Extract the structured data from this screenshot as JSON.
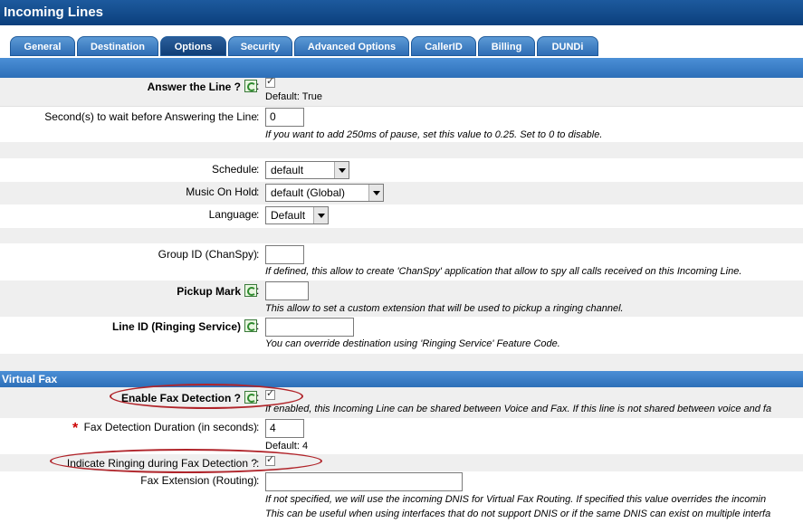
{
  "window": {
    "title": "Incoming Lines"
  },
  "tabs": [
    {
      "label": "General"
    },
    {
      "label": "Destination"
    },
    {
      "label": "Options",
      "active": true
    },
    {
      "label": "Security"
    },
    {
      "label": "Advanced Options"
    },
    {
      "label": "CallerID"
    },
    {
      "label": "Billing"
    },
    {
      "label": "DUNDi"
    }
  ],
  "options": {
    "answer_line": {
      "label": "Answer the Line ?",
      "checked": true,
      "default": "Default: True"
    },
    "wait_seconds": {
      "label": "Second(s) to wait before Answering the Line",
      "value": "0",
      "note": "If you want to add 250ms of pause, set this value to 0.25. Set to 0 to disable."
    },
    "schedule": {
      "label": "Schedule",
      "value": "default"
    },
    "music_on_hold": {
      "label": "Music On Hold",
      "value": "default (Global)"
    },
    "language": {
      "label": "Language",
      "value": "Default"
    },
    "group_id": {
      "label": "Group ID (ChanSpy)",
      "value": "",
      "note": "If defined, this allow to create 'ChanSpy' application that allow to spy all calls received on this Incoming Line."
    },
    "pickup_mark": {
      "label": "Pickup Mark",
      "value": "",
      "note": "This allow to set a custom extension that will be used to pickup a ringing channel."
    },
    "line_id": {
      "label": "Line ID (Ringing Service)",
      "value": "",
      "note": "You can override destination using 'Ringing Service' Feature Code."
    }
  },
  "virtual_fax": {
    "section_title": "Virtual Fax",
    "enable_fax_detection": {
      "label": "Enable Fax Detection ?",
      "checked": true,
      "note": "If enabled, this Incoming Line can be shared between Voice and Fax. If this line is not shared between voice and fa"
    },
    "fax_detection_duration": {
      "required_mark": "*",
      "label": "Fax Detection Duration (in seconds)",
      "value": "4",
      "default": "Default: 4"
    },
    "indicate_ringing": {
      "label": "Indicate Ringing during Fax Detection ?",
      "checked": true
    },
    "fax_extension": {
      "label": "Fax Extension (Routing)",
      "value": "",
      "note1": "If not specified, we will use the incoming DNIS for Virtual Fax Routing. If specified this value overrides the incomin",
      "note2": "This can be useful when using interfaces that do not support DNIS or if the same DNIS can exist on multiple interfa"
    }
  },
  "colon": ":",
  "colors": {
    "accent": "#2d6fb8",
    "title_bar": "#0b3f7c",
    "highlight_ellipse": "#b0242a"
  }
}
